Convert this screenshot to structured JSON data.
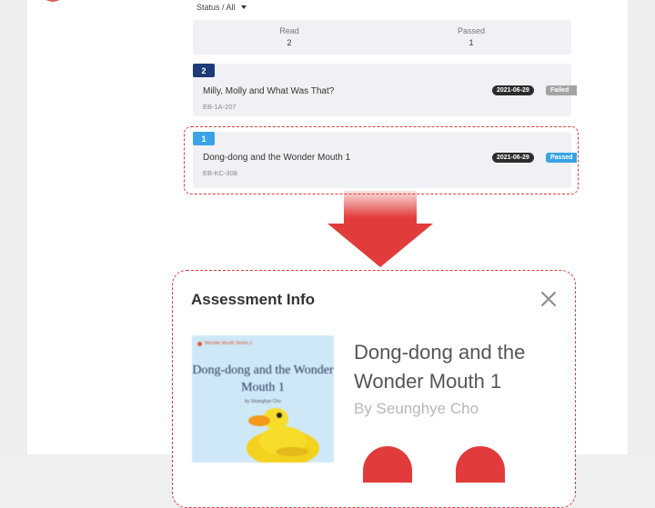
{
  "filter": {
    "label": "Status / All"
  },
  "stats": [
    {
      "label": "Read",
      "value": "2"
    },
    {
      "label": "Passed",
      "value": "1"
    }
  ],
  "records": [
    {
      "number": "2",
      "title": "Milly, Molly and What Was That?",
      "code": "EB-1A-207",
      "date": "2021-06-29",
      "status": "Failed",
      "tag_color": "#1e3a78",
      "status_color": "#a3a3a3"
    },
    {
      "number": "1",
      "title": "Dong-dong and the Wonder Mouth 1",
      "code": "EB-KC-308",
      "date": "2021-06-29",
      "status": "Passed",
      "tag_color": "#3aa3e6",
      "status_color": "#3aa3e6"
    }
  ],
  "panel": {
    "title": "Assessment Info",
    "close_icon": "close-icon",
    "book": {
      "cover_series": "Wonder Mouth Series 1",
      "cover_title": "Dong-dong and the Wonder Mouth 1",
      "cover_author": "by Seunghye Cho",
      "title": "Dong-dong and the Wonder Mouth 1",
      "author": "By Seunghye Cho"
    }
  },
  "colors": {
    "highlight": "#e23b3b",
    "card_bg": "#f0f1f4"
  }
}
